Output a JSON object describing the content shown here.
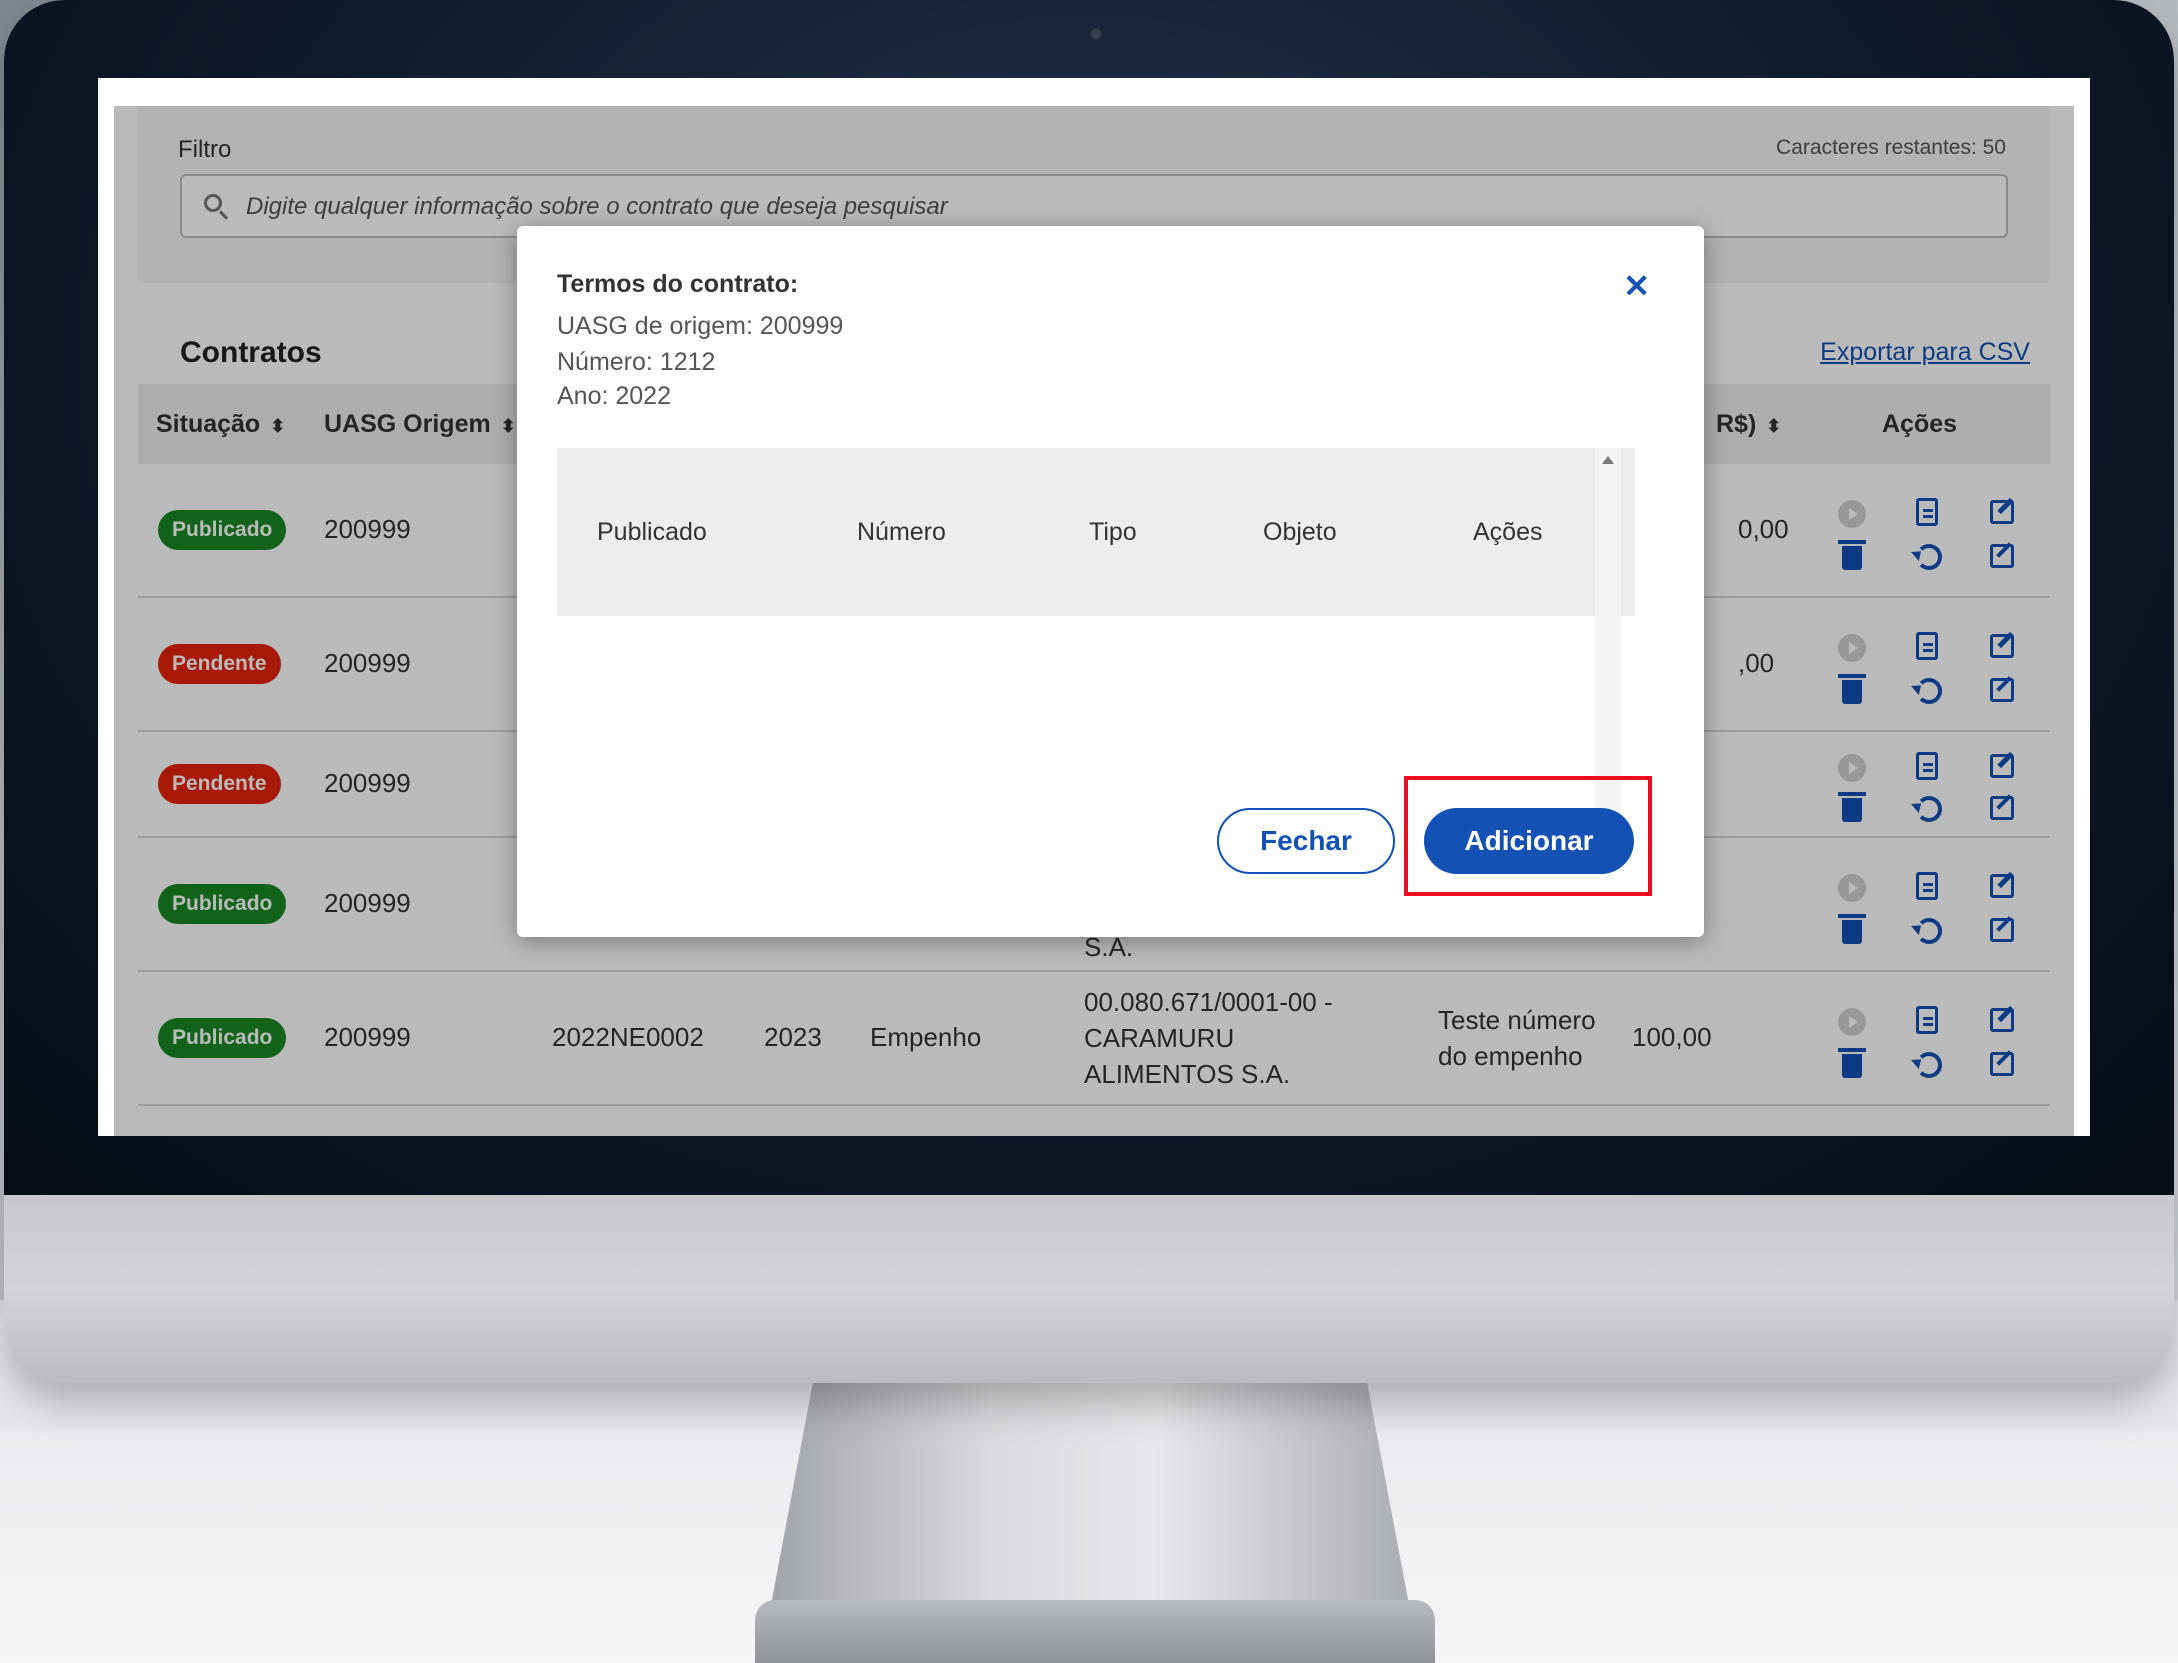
{
  "filter": {
    "label": "Filtro",
    "remaining": "Caracteres restantes: 50",
    "placeholder": "Digite qualquer informação sobre o contrato que deseja pesquisar"
  },
  "contracts": {
    "title": "Contratos",
    "export_label": "Exportar para CSV",
    "columns": {
      "situacao": "Situação",
      "uasg": "UASG Origem",
      "valor": "R$)",
      "acoes": "Ações"
    },
    "rows": [
      {
        "status": "Publicado",
        "uasg": "200999",
        "value_partial": "0,00"
      },
      {
        "status": "Pendente",
        "uasg": "200999",
        "value_partial": ",00"
      },
      {
        "status": "Pendente",
        "uasg": "200999",
        "value_partial": ""
      },
      {
        "status": "Publicado",
        "uasg": "200999",
        "fornecedor_tail": "S.A."
      },
      {
        "status": "Publicado",
        "uasg": "200999",
        "numero": "2022NE0002",
        "ano": "2023",
        "tipo": "Empenho",
        "fornecedor": "00.080.671/0001-00 - CARAMURU ALIMENTOS S.A.",
        "objeto": "Teste número do empenho",
        "valor": "100,00"
      }
    ]
  },
  "modal": {
    "title": "Termos do contrato:",
    "uasg": "UASG de origem: 200999",
    "numero": "Número: 1212",
    "ano": "Ano: 2022",
    "table_headers": [
      "Publicado",
      "Número",
      "Tipo",
      "Objeto",
      "Ações"
    ],
    "close_button": "Fechar",
    "add_button": "Adicionar"
  },
  "colors": {
    "primary": "#1351b4",
    "published": "#168821",
    "pending": "#e52207",
    "highlight": "#e8101e"
  }
}
